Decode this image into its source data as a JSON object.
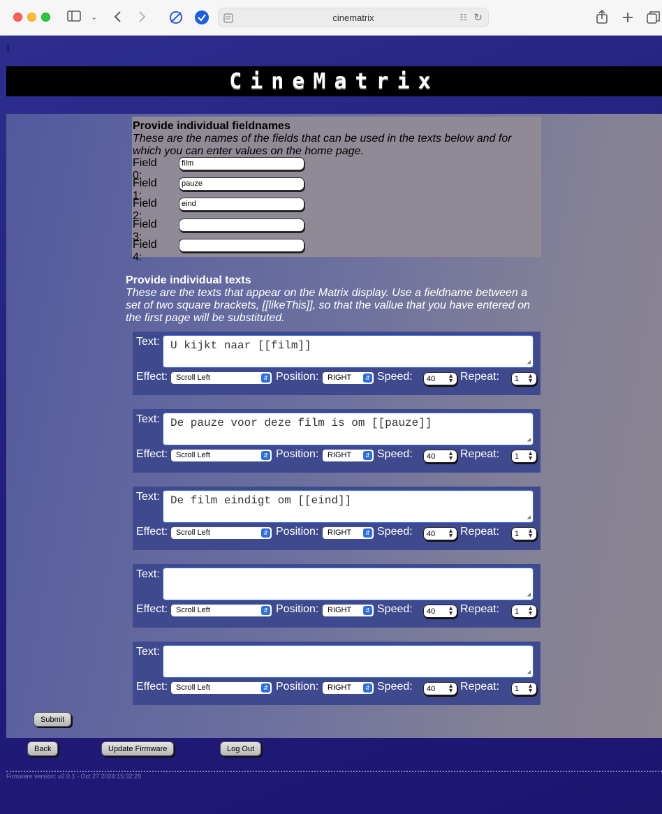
{
  "browser": {
    "url": "cinematrix"
  },
  "banner": {
    "title": "CineMatrix"
  },
  "fields_section": {
    "title": "Provide individual fieldnames",
    "description": "These are the names of the fields that can be used in the texts below and for which you can enter values on the home page.",
    "fields": [
      {
        "label": "Field 0:",
        "value": "film"
      },
      {
        "label": "Field 1:",
        "value": "pauze"
      },
      {
        "label": "Field 2:",
        "value": "eind"
      },
      {
        "label": "Field 3:",
        "value": ""
      },
      {
        "label": "Field 4:",
        "value": ""
      }
    ]
  },
  "texts_section": {
    "title": "Provide individual texts",
    "description": "These are the texts that appear on the Matrix display. Use a fieldname between a set of two square brackets, [[likeThis]], so that the vallue that you have entered on the first page will be substituted.",
    "labels": {
      "text": "Text:",
      "effect": "Effect:",
      "position": "Position:",
      "speed": "Speed:",
      "repeat": "Repeat:"
    },
    "blocks": [
      {
        "text": "U kijkt naar [[film]]",
        "effect": "Scroll Left",
        "position": "RIGHT",
        "speed": "40",
        "repeat": "1"
      },
      {
        "text": "De pauze voor deze film is om [[pauze]]",
        "effect": "Scroll Left",
        "position": "RIGHT",
        "speed": "40",
        "repeat": "1"
      },
      {
        "text": "De film eindigt om [[eind]]",
        "effect": "Scroll Left",
        "position": "RIGHT",
        "speed": "40",
        "repeat": "1"
      },
      {
        "text": "",
        "effect": "Scroll Left",
        "position": "RIGHT",
        "speed": "40",
        "repeat": "1"
      },
      {
        "text": "",
        "effect": "Scroll Left",
        "position": "RIGHT",
        "speed": "40",
        "repeat": "1"
      }
    ]
  },
  "buttons": {
    "submit": "Submit",
    "back": "Back",
    "update_firmware": "Update Firmware",
    "log_out": "Log Out"
  },
  "footer": {
    "firmware": "Firmware version: v2.0.1 - Oct 27 2024:15:32:28"
  },
  "icons": {
    "sidebar": "sidebar-icon",
    "back": "chevron-left-icon",
    "forward": "chevron-right-icon",
    "share": "share-icon",
    "new_tab": "plus-icon",
    "tabs": "tabs-overview-icon"
  }
}
